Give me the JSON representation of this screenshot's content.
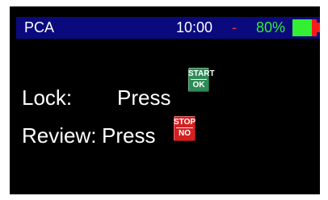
{
  "status_bar": {
    "title": "PCA",
    "time": "10:00",
    "separator": "-",
    "battery_percent": "80%",
    "battery_level": 0.8
  },
  "lock": {
    "label": "Lock:",
    "action": "Press",
    "key_top": "START",
    "key_bottom": "OK"
  },
  "review": {
    "label": "Review:",
    "action": "Press",
    "key_top": "STOP",
    "key_bottom": "NO"
  },
  "colors": {
    "screen_background": "#000000",
    "status_bar_background": "#0a0a7e",
    "battery_fill": "#33ee33",
    "battery_empty": "#ff1a1a",
    "start_key": "#2e8b57",
    "stop_key": "#d42020"
  }
}
